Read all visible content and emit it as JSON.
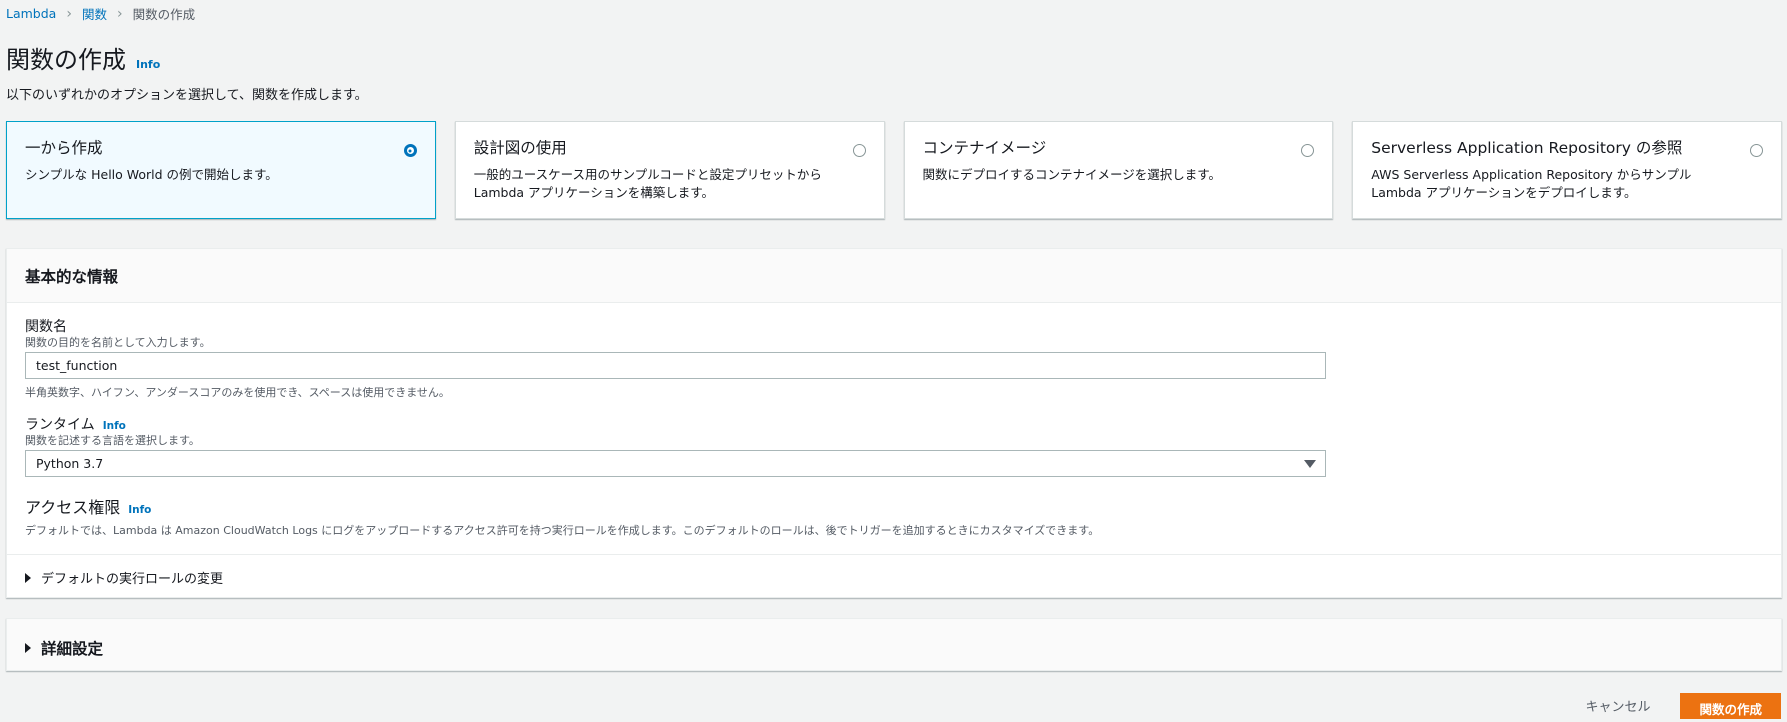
{
  "breadcrumb": [
    {
      "label": "Lambda"
    },
    {
      "label": "関数"
    },
    {
      "label": "関数の作成"
    }
  ],
  "page": {
    "title": "関数の作成",
    "info": "Info",
    "description": "以下のいずれかのオプションを選択して、関数を作成します。"
  },
  "options": [
    {
      "title": "一から作成",
      "description": "シンプルな Hello World の例で開始します。",
      "selected": true
    },
    {
      "title": "設計図の使用",
      "description": "一般的ユースケース用のサンプルコードと設定プリセットから Lambda アプリケーションを構築します。",
      "selected": false
    },
    {
      "title": "コンテナイメージ",
      "description": "関数にデプロイするコンテナイメージを選択します。",
      "selected": false
    },
    {
      "title": "Serverless Application Repository の参照",
      "description": "AWS Serverless Application Repository からサンプル Lambda アプリケーションをデプロイします。",
      "selected": false
    }
  ],
  "basic": {
    "header": "基本的な情報",
    "function_name": {
      "label": "関数名",
      "description": "関数の目的を名前として入力します。",
      "value": "test_function",
      "hint": "半角英数字、ハイフン、アンダースコアのみを使用でき、スペースは使用できません。"
    },
    "runtime": {
      "label": "ランタイム",
      "info": "Info",
      "description": "関数を記述する言語を選択します。",
      "value": "Python 3.7"
    },
    "permissions": {
      "label": "アクセス権限",
      "info": "Info",
      "description": "デフォルトでは、Lambda は Amazon CloudWatch Logs にログをアップロードするアクセス許可を持つ実行ロールを作成します。このデフォルトのロールは、後でトリガーを追加するときにカスタマイズできます。",
      "change_role": "デフォルトの実行ロールの変更"
    }
  },
  "advanced": {
    "header": "詳細設定"
  },
  "actions": {
    "cancel": "キャンセル",
    "create": "関数の作成"
  },
  "colors": {
    "link": "#0073bb",
    "primary": "#ec7211",
    "selected_bg": "#f1faff",
    "selected_border": "#00a1c9"
  }
}
